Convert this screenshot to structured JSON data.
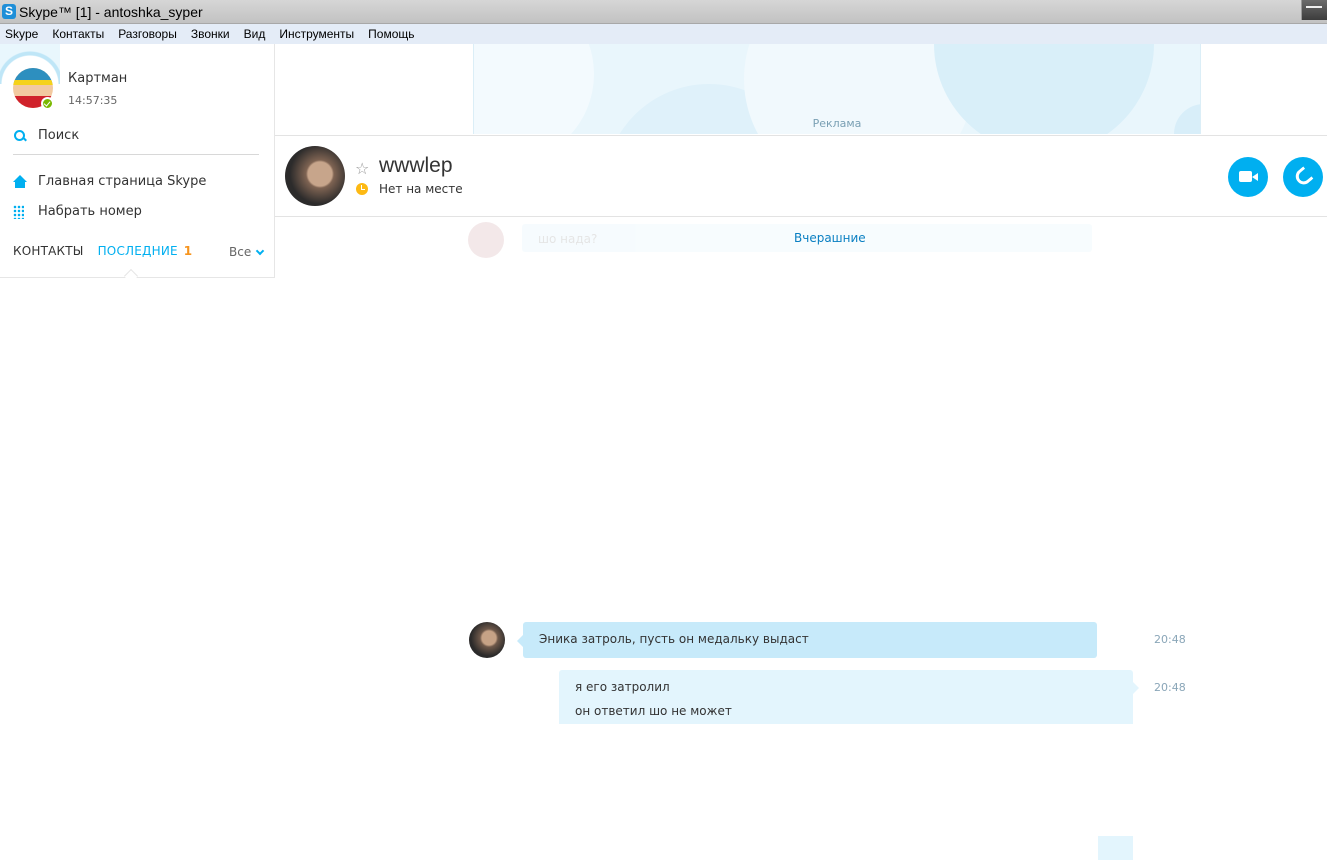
{
  "window": {
    "title": "Skype™ [1] - antoshka_syper",
    "app_icon": "skype-icon"
  },
  "menu": [
    "Skype",
    "Контакты",
    "Разговоры",
    "Звонки",
    "Вид",
    "Инструменты",
    "Помощь"
  ],
  "profile": {
    "name": "Картман",
    "time": "14:57:35",
    "status": "online"
  },
  "sidebar": {
    "search_label": "Поиск",
    "home_label": "Главная страница Skype",
    "dial_label": "Набрать номер",
    "tab_contacts": "КОНТАКТЫ",
    "tab_recent": "ПОСЛЕДНИЕ",
    "recent_badge": "1",
    "filter_label": "Все"
  },
  "ad": {
    "label": "Реклама"
  },
  "chat": {
    "contact_name": "wwwlep",
    "contact_status": "Нет на месте",
    "day_separator": "Вчерашние",
    "faded_text": "шо нада?",
    "messages": [
      {
        "direction": "in",
        "text": "Эника затроль, пусть он медальку выдаст",
        "time": "20:48"
      },
      {
        "direction": "out",
        "lines": [
          "я его затролил",
          "он ответил шо не может"
        ],
        "time": "20:48"
      }
    ]
  },
  "colors": {
    "accent": "#00aff0",
    "badge": "#f7941d",
    "bubble_in": "#c7eafa",
    "bubble_out": "#e3f5fd"
  }
}
